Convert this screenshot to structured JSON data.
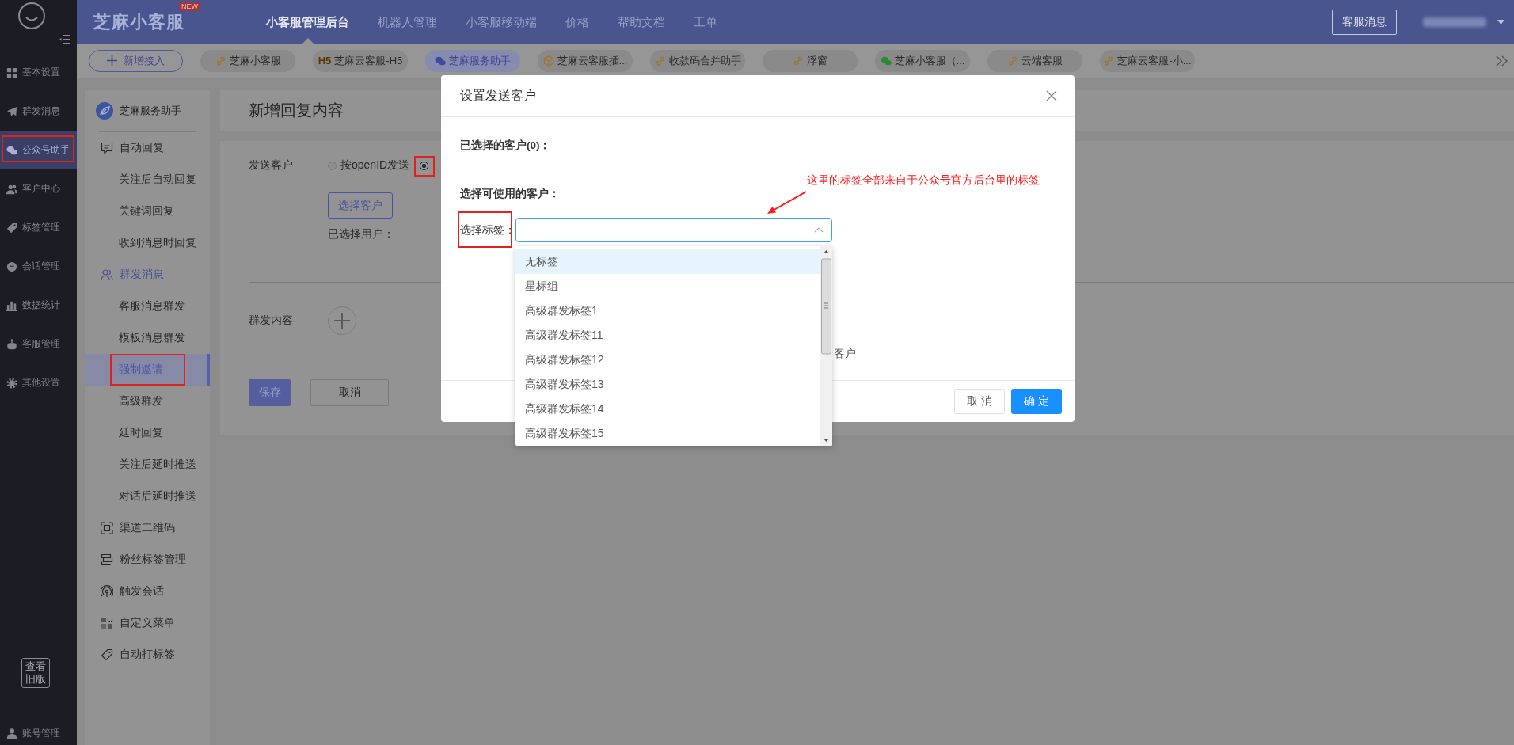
{
  "sidebar": {
    "items": [
      {
        "label": "基本设置",
        "selected": false,
        "annotated": false
      },
      {
        "label": "群发消息",
        "selected": false,
        "annotated": false
      },
      {
        "label": "公众号助手",
        "selected": true,
        "annotated": true
      },
      {
        "label": "客户中心",
        "selected": false,
        "annotated": false
      },
      {
        "label": "标签管理",
        "selected": false,
        "annotated": false
      },
      {
        "label": "会话管理",
        "selected": false,
        "annotated": false
      },
      {
        "label": "数据统计",
        "selected": false,
        "annotated": false
      },
      {
        "label": "客服管理",
        "selected": false,
        "annotated": false
      },
      {
        "label": "其他设置",
        "selected": false,
        "annotated": false
      }
    ],
    "old_version_button": "查看旧版",
    "account": "账号管理"
  },
  "header": {
    "logo": "芝麻小客服",
    "badge": "NEW",
    "nav": [
      {
        "label": "小客服管理后台",
        "selected": true
      },
      {
        "label": "机器人管理",
        "selected": false
      },
      {
        "label": "小客服移动端",
        "selected": false
      },
      {
        "label": "价格",
        "selected": false
      },
      {
        "label": "帮助文档",
        "selected": false
      },
      {
        "label": "工单",
        "selected": false
      }
    ],
    "message_button": "客服消息"
  },
  "channel_tabs": {
    "add_button": "新增接入",
    "tabs": [
      {
        "label": "芝麻小客服",
        "selected": false
      },
      {
        "prefix": "H5",
        "label": "芝麻云客服-H5",
        "selected": false
      },
      {
        "label": "芝麻服务助手",
        "selected": true
      },
      {
        "label": "芝麻云客服插...",
        "selected": false
      },
      {
        "label": "收款码合并助手",
        "selected": false
      },
      {
        "label": "浮窗",
        "selected": false
      },
      {
        "label": "芝麻小客服（...",
        "selected": false
      },
      {
        "label": "云端客服",
        "selected": false
      },
      {
        "label": "芝麻云客服-小...",
        "selected": false
      }
    ]
  },
  "submenu": {
    "title": "芝麻服务助手",
    "groups": [
      {
        "label": "自动回复",
        "active": false,
        "children": [
          {
            "label": "关注后自动回复",
            "selected": false,
            "annotated": false
          },
          {
            "label": "关键词回复",
            "selected": false,
            "annotated": false
          },
          {
            "label": "收到消息时回复",
            "selected": false,
            "annotated": false
          }
        ]
      },
      {
        "label": "群发消息",
        "active": true,
        "children": [
          {
            "label": "客服消息群发",
            "selected": false,
            "annotated": false
          },
          {
            "label": "模板消息群发",
            "selected": false,
            "annotated": false
          },
          {
            "label": "强制邀请",
            "selected": true,
            "annotated": true
          },
          {
            "label": "高级群发",
            "selected": false,
            "annotated": false
          },
          {
            "label": "延时回复",
            "selected": false,
            "annotated": false
          },
          {
            "label": "关注后延时推送",
            "selected": false,
            "annotated": false
          },
          {
            "label": "对话后延时推送",
            "selected": false,
            "annotated": false
          }
        ]
      },
      {
        "label": "渠道二维码",
        "active": false
      },
      {
        "label": "粉丝标签管理",
        "active": false
      },
      {
        "label": "触发会话",
        "active": false
      },
      {
        "label": "自定义菜单",
        "active": false
      },
      {
        "label": "自动打标签",
        "active": false
      }
    ]
  },
  "page": {
    "title": "新增回复内容",
    "send_label": "发送客户",
    "radios": [
      {
        "label": "按openID发送",
        "selected": false,
        "annotated": false
      },
      {
        "selected": true,
        "annotated": true
      }
    ],
    "choose_button": "选择客户",
    "selected_users_label": "已选择用户：",
    "content_label": "群发内容",
    "save_button": "保存",
    "cancel_button": "取消"
  },
  "modal": {
    "title": "设置发送客户",
    "selected_count_label": "已选择的客户(0)：",
    "available_label": "选择可使用的客户：",
    "tag_label": {
      "text": "选择标签：",
      "annotated": true
    },
    "tag_select": {
      "expanded": true,
      "options": [
        {
          "label": "无标签",
          "selected": true
        },
        {
          "label": "星标组",
          "selected": false
        },
        {
          "label": "高级群发标签1",
          "selected": false
        },
        {
          "label": "高级群发标签11",
          "selected": false
        },
        {
          "label": "高级群发标签12",
          "selected": false
        },
        {
          "label": "高级群发标签13",
          "selected": false
        },
        {
          "label": "高级群发标签14",
          "selected": false
        },
        {
          "label": "高级群发标签15",
          "selected": false
        }
      ]
    },
    "covered_text": "客户",
    "cancel_button": "取 消",
    "confirm_button": "确 定"
  },
  "annotation": {
    "text": "这里的标签全部来自于公众号官方后台里的标签"
  }
}
